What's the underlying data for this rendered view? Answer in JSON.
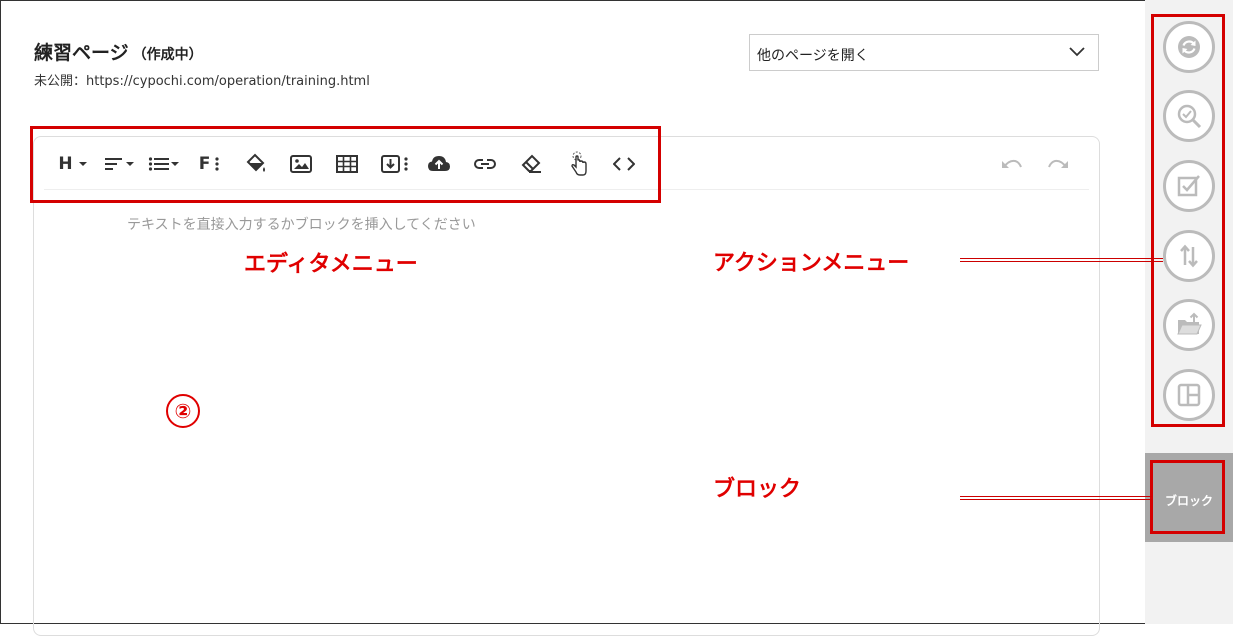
{
  "header": {
    "title": "練習ページ",
    "status": "（作成中）",
    "url": "未公開：https://cypochi.com/operation/training.html"
  },
  "open_page_select": {
    "label": "他のページを開く"
  },
  "toolbar": {
    "heading_label": "H",
    "font_label": "F",
    "tools": [
      "heading-icon",
      "align-icon",
      "list-icon",
      "font-icon",
      "paint-bucket-icon",
      "image-icon",
      "table-icon",
      "download-box-icon",
      "upload-cloud-icon",
      "link-icon",
      "eraser-icon",
      "pointer-hand-icon",
      "code-icon",
      "undo-icon",
      "redo-icon"
    ]
  },
  "editor": {
    "placeholder": "テキストを直接入力するかブロックを挿入してください"
  },
  "annotations": {
    "editor_menu": "エディタメニュー",
    "action_menu": "アクションメニュー",
    "block": "ブロック",
    "number": "②",
    "color": "#e00000"
  },
  "side_panel": {
    "actions": [
      "refresh-icon",
      "search-check-icon",
      "checkbox-icon",
      "sort-icon",
      "folder-upload-icon",
      "layout-icon"
    ],
    "block_button_label": "ブロック"
  }
}
